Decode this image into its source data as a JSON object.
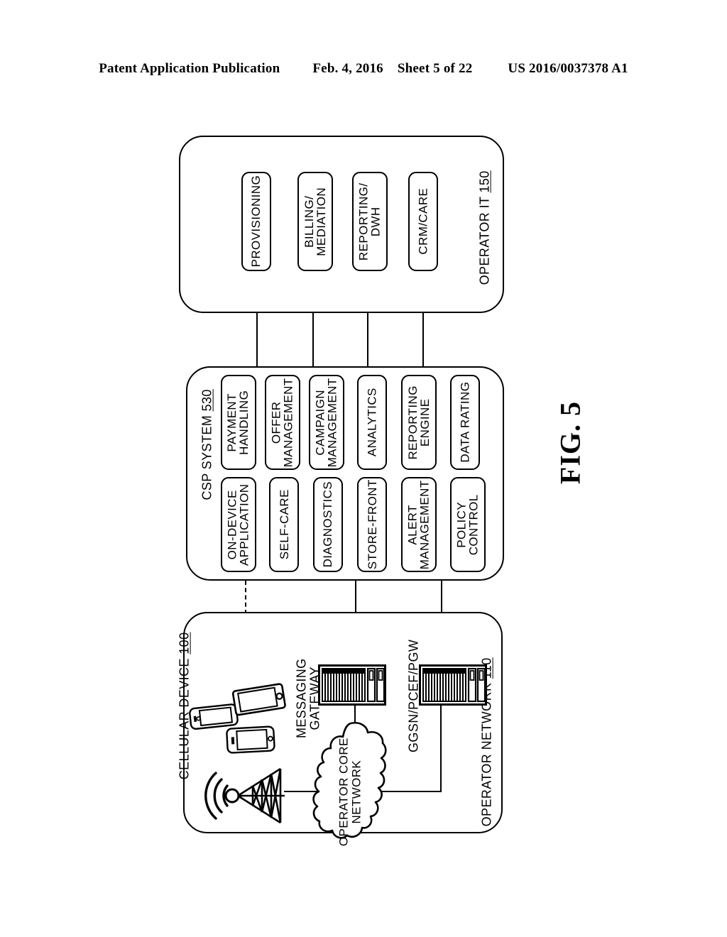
{
  "header": {
    "publication": "Patent Application Publication",
    "date": "Feb. 4, 2016",
    "sheet": "Sheet 5 of 22",
    "patent_number": "US 2016/0037378 A1"
  },
  "figure": {
    "label": "FIG. 5"
  },
  "operator_it": {
    "title": "OPERATOR IT",
    "ref": "150",
    "modules": [
      {
        "label": "PROVISIONING",
        "lines": [
          "PROVISIONING"
        ]
      },
      {
        "label": "BILLING/ MEDIATION",
        "lines": [
          "BILLING/",
          "MEDIATION"
        ]
      },
      {
        "label": "REPORTING/ DWH",
        "lines": [
          "REPORTING/",
          "DWH"
        ]
      },
      {
        "label": "CRM/CARE",
        "lines": [
          "CRM/CARE"
        ]
      }
    ]
  },
  "csp_system": {
    "title": "CSP SYSTEM",
    "ref": "530",
    "row_outer": [
      {
        "label": "PAYMENT HANDLING",
        "lines": [
          "PAYMENT",
          "HANDLING"
        ]
      },
      {
        "label": "OFFER MANAGEMENT",
        "lines": [
          "OFFER",
          "MANAGEMENT"
        ]
      },
      {
        "label": "CAMPAIGN MANAGEMENT",
        "lines": [
          "CAMPAIGN",
          "MANAGEMENT"
        ]
      },
      {
        "label": "ANALYTICS",
        "lines": [
          "ANALYTICS"
        ]
      },
      {
        "label": "REPORTING ENGINE",
        "lines": [
          "REPORTING",
          "ENGINE"
        ]
      },
      {
        "label": "DATA RATING",
        "lines": [
          "DATA RATING"
        ]
      }
    ],
    "row_inner": [
      {
        "label": "ON-DEVICE APPLICATION",
        "lines": [
          "ON-DEVICE",
          "APPLICATION"
        ]
      },
      {
        "label": "SELF-CARE",
        "lines": [
          "SELF-CARE"
        ]
      },
      {
        "label": "DIAGNOSTICS",
        "lines": [
          "DIAGNOSTICS"
        ]
      },
      {
        "label": "STORE-FRONT",
        "lines": [
          "STORE-FRONT"
        ]
      },
      {
        "label": "ALERT MANAGEMENT",
        "lines": [
          "ALERT",
          "MANAGEMENT"
        ]
      },
      {
        "label": "POLICY CONTROL",
        "lines": [
          "POLICY",
          "CONTROL"
        ]
      }
    ]
  },
  "operator_network": {
    "title": "OPERATOR NETWORK",
    "ref": "110",
    "cellular_device_title": "CELLULAR DEVICE",
    "cellular_device_ref": "100",
    "messaging_gateway": {
      "lines": [
        "MESSAGING",
        "GATEWAY"
      ]
    },
    "ggsn": {
      "lines": [
        "GGSN/PCEF/PGW"
      ]
    },
    "core_network": {
      "lines": [
        "OPERATOR CORE",
        "NETWORK"
      ]
    }
  },
  "icons": {
    "phone_landscape": "phone-icon",
    "phone_tilted": "phone-icon",
    "phone_portrait": "phone-icon",
    "cell_tower": "cell-tower-icon",
    "server_rack": "server-rack-icon",
    "cloud": "cloud-icon"
  },
  "colors": {
    "ink": "#000000",
    "paper": "#ffffff"
  }
}
